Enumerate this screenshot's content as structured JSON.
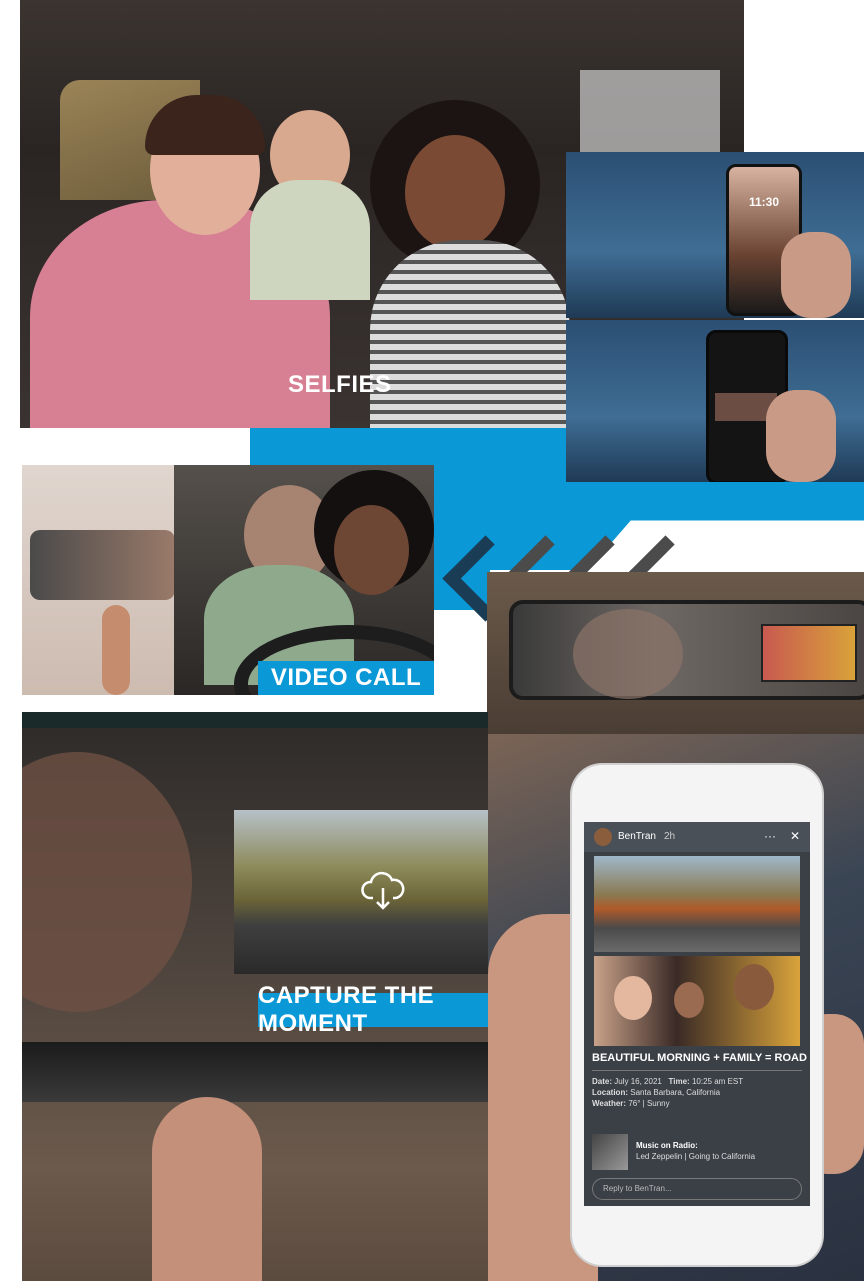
{
  "labels": {
    "selfies": "SELFIES",
    "video_call": "VIDEO CALL",
    "capture": "CAPTURE THE MOMENT"
  },
  "phone_lock": {
    "time": "11:30"
  },
  "post": {
    "username": "BenTran",
    "age": "2h",
    "menu": "···",
    "close": "✕",
    "title": "BEAUTIFUL MORNING + FAMILY = ROAD TRIP",
    "date_label": "Date:",
    "date": "July 16, 2021",
    "time_label": "Time:",
    "time": "10:25 am EST",
    "location_label": "Location:",
    "location": "Santa Barbara, California",
    "weather_label": "Weather:",
    "weather": "76° | Sunny",
    "music_label": "Music on Radio:",
    "music": "Led Zeppelin | Going to California",
    "reply_placeholder": "Reply to BenTran..."
  },
  "icons": {
    "cloud": "cloud-download-icon",
    "arrows": "chevron-left-icon"
  },
  "colors": {
    "accent": "#0b98d6",
    "navy": "#1a3c55"
  }
}
